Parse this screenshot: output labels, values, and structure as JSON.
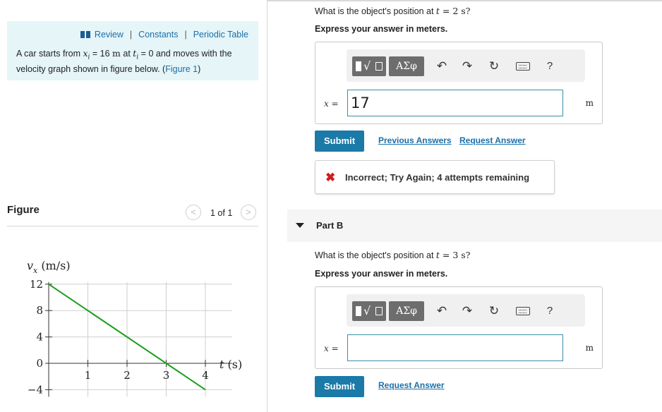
{
  "intro": {
    "links": {
      "review": "Review",
      "constants": "Constants",
      "periodic_table": "Periodic Table",
      "separator": "|"
    },
    "problem": {
      "text_1": "A car starts from ",
      "xi_symbol": "x",
      "xi_sub": "i",
      "eq": " = 16 ",
      "unit_m": "m",
      "at": " at ",
      "ti_symbol": "t",
      "ti_sub": "i",
      "text_2": " = 0 and moves with the velocity graph shown in figure below. (",
      "figure_link": "Figure 1",
      "close_paren": ")"
    }
  },
  "figure": {
    "title": "Figure",
    "pager_count": "1 of 1",
    "prev_glyph": "<",
    "next_glyph": ">"
  },
  "chart_data": {
    "type": "line",
    "ylabel_var": "v",
    "ylabel_sub": "x",
    "ylabel_unit": "(m/s)",
    "xlabel_var": "t",
    "xlabel_unit": "(s)",
    "xlim": [
      0,
      4.5
    ],
    "ylim": [
      -4,
      12
    ],
    "x_ticks": [
      1,
      2,
      3,
      4
    ],
    "x_tick_labels": [
      "1",
      "2",
      "3",
      "4"
    ],
    "y_ticks": [
      -4,
      0,
      4,
      8,
      12
    ],
    "y_tick_labels": [
      "−4",
      "0",
      "4",
      "8",
      "12"
    ],
    "grid": true,
    "series": [
      {
        "x": [
          0,
          4
        ],
        "y": [
          12,
          -4
        ],
        "color": "#1a9e1a"
      }
    ]
  },
  "partA": {
    "question_prefix": "What is the object's position at ",
    "t_var": "t",
    "t_value": " = 2 s?",
    "instruction": "Express your answer in meters.",
    "toolbar": {
      "templates_label": "√",
      "greek_label": "ΑΣφ",
      "help_label": "?"
    },
    "answer_label": "x =",
    "answer_value": "17",
    "unit": "m",
    "submit_label": "Submit",
    "previous_answers_label": "Previous Answers",
    "request_answer_label": "Request Answer",
    "feedback_icon": "✖",
    "feedback_text": "Incorrect; Try Again; 4 attempts remaining"
  },
  "partB": {
    "title": "Part B",
    "question_prefix": "What is the object's position at ",
    "t_var": "t",
    "t_value": " = 3 s?",
    "instruction": "Express your answer in meters.",
    "toolbar": {
      "templates_label": "√",
      "greek_label": "ΑΣφ",
      "help_label": "?"
    },
    "answer_label": "x =",
    "answer_value": "",
    "unit": "m",
    "submit_label": "Submit",
    "request_answer_label": "Request Answer"
  },
  "colors": {
    "accent": "#1b7aa8",
    "link": "#1b6fa8",
    "intro_bg": "#e5f5f8",
    "error": "#d01d1d",
    "graph_line": "#1a9e1a"
  }
}
